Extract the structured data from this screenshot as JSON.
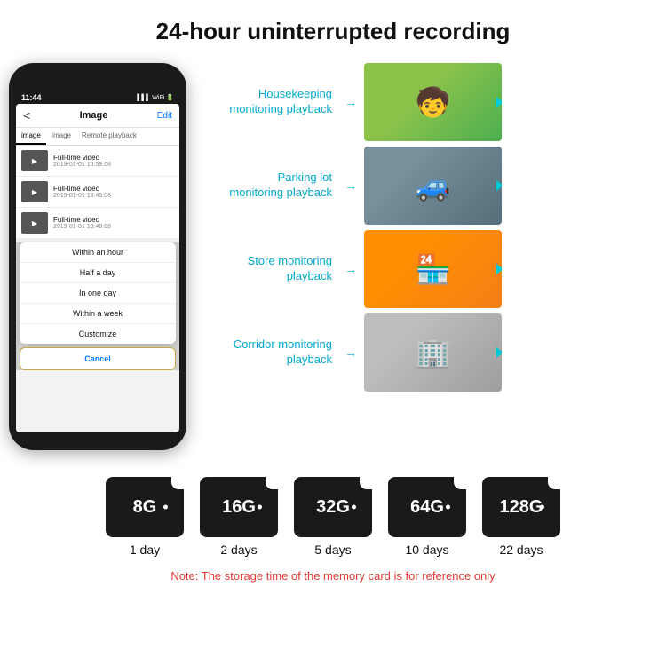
{
  "title": "24-hour uninterrupted recording",
  "phone": {
    "time": "11:44",
    "screen_title": "Image",
    "back": "<",
    "edit": "Edit",
    "tabs": [
      "image",
      "Image",
      "Remote playback"
    ],
    "videos": [
      {
        "title": "Full-time video",
        "date": "2019-01-01 15:59:08"
      },
      {
        "title": "Full-time video",
        "date": "2019-01-01 13:45:08"
      },
      {
        "title": "Full-time video",
        "date": "2019-01-01 13:40:08"
      }
    ],
    "dropdown_items": [
      "Within an hour",
      "Half a day",
      "In one day",
      "Within a week",
      "Customize"
    ],
    "cancel": "Cancel"
  },
  "monitoring": [
    {
      "label": "Housekeeping\nmonitoring playback",
      "photo_type": "child",
      "emoji": "🧒"
    },
    {
      "label": "Parking lot\nmonitoring playback",
      "photo_type": "parking",
      "emoji": "🚗"
    },
    {
      "label": "Store monitoring\nplayback",
      "photo_type": "store",
      "emoji": "🏪"
    },
    {
      "label": "Corridor monitoring\nplayback",
      "photo_type": "corridor",
      "emoji": "🏢"
    }
  ],
  "sd_cards": [
    {
      "size": "8G",
      "days": "1 day"
    },
    {
      "size": "16G",
      "days": "2 days"
    },
    {
      "size": "32G",
      "days": "5 days"
    },
    {
      "size": "64G",
      "days": "10 days"
    },
    {
      "size": "128G",
      "days": "22 days"
    }
  ],
  "note": "Note: The storage time of the memory card is for reference only"
}
